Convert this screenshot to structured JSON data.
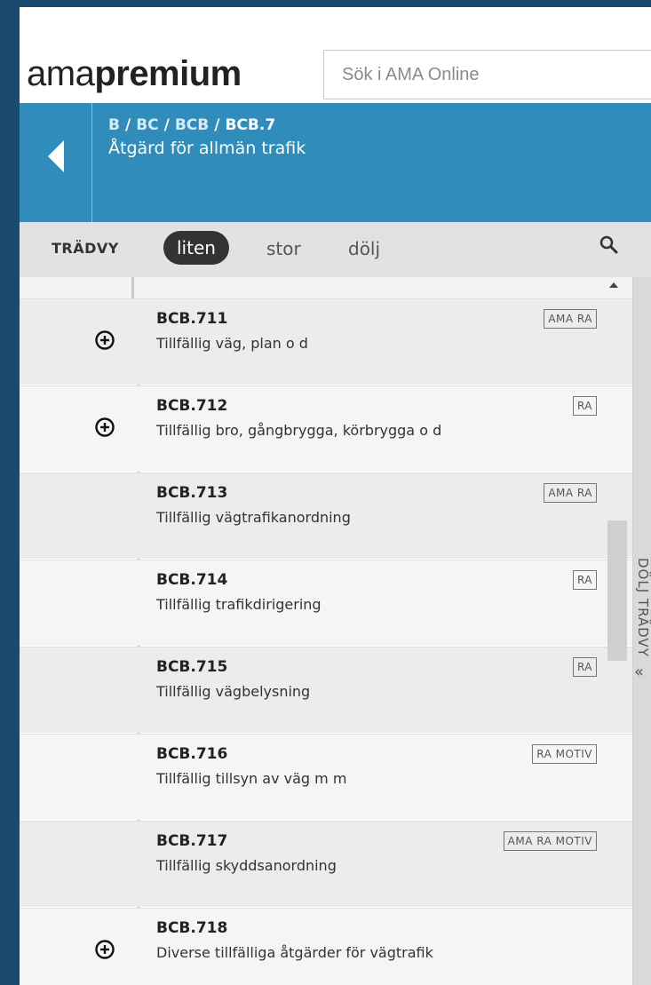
{
  "header": {
    "logo_light": "ama",
    "logo_bold": "premium",
    "search_placeholder": "Sök i AMA Online"
  },
  "navbar": {
    "breadcrumb": [
      "B",
      "BC",
      "BCB",
      "BCB.7"
    ],
    "separator": "/",
    "title": "Åtgärd för allmän trafik"
  },
  "tree_toolbar": {
    "label": "TRÄDVY",
    "sizes": [
      "liten",
      "stor",
      "dölj"
    ],
    "active_size": "liten"
  },
  "items": [
    {
      "code": "BCB.711",
      "description": "Tillfällig väg, plan o d",
      "badge": "AMA RA",
      "expandable": true
    },
    {
      "code": "BCB.712",
      "description": "Tillfällig bro, gångbrygga, körbrygga o d",
      "badge": "RA",
      "expandable": true
    },
    {
      "code": "BCB.713",
      "description": "Tillfällig vägtrafikanordning",
      "badge": "AMA RA",
      "expandable": false
    },
    {
      "code": "BCB.714",
      "description": "Tillfällig trafikdirigering",
      "badge": "RA",
      "expandable": false
    },
    {
      "code": "BCB.715",
      "description": "Tillfällig vägbelysning",
      "badge": "RA",
      "expandable": false
    },
    {
      "code": "BCB.716",
      "description": "Tillfällig tillsyn av väg m m",
      "badge": "RA MOTIV",
      "expandable": false
    },
    {
      "code": "BCB.717",
      "description": "Tillfällig skyddsanordning",
      "badge": "AMA RA MOTIV",
      "expandable": false
    },
    {
      "code": "BCB.718",
      "description": "Diverse tillfälliga åtgärder för vägtrafik",
      "badge": "",
      "expandable": true
    }
  ],
  "collapse_panel": {
    "label": "DÖLJ TRÄDVY",
    "icon": "double-chevron-left-icon"
  }
}
